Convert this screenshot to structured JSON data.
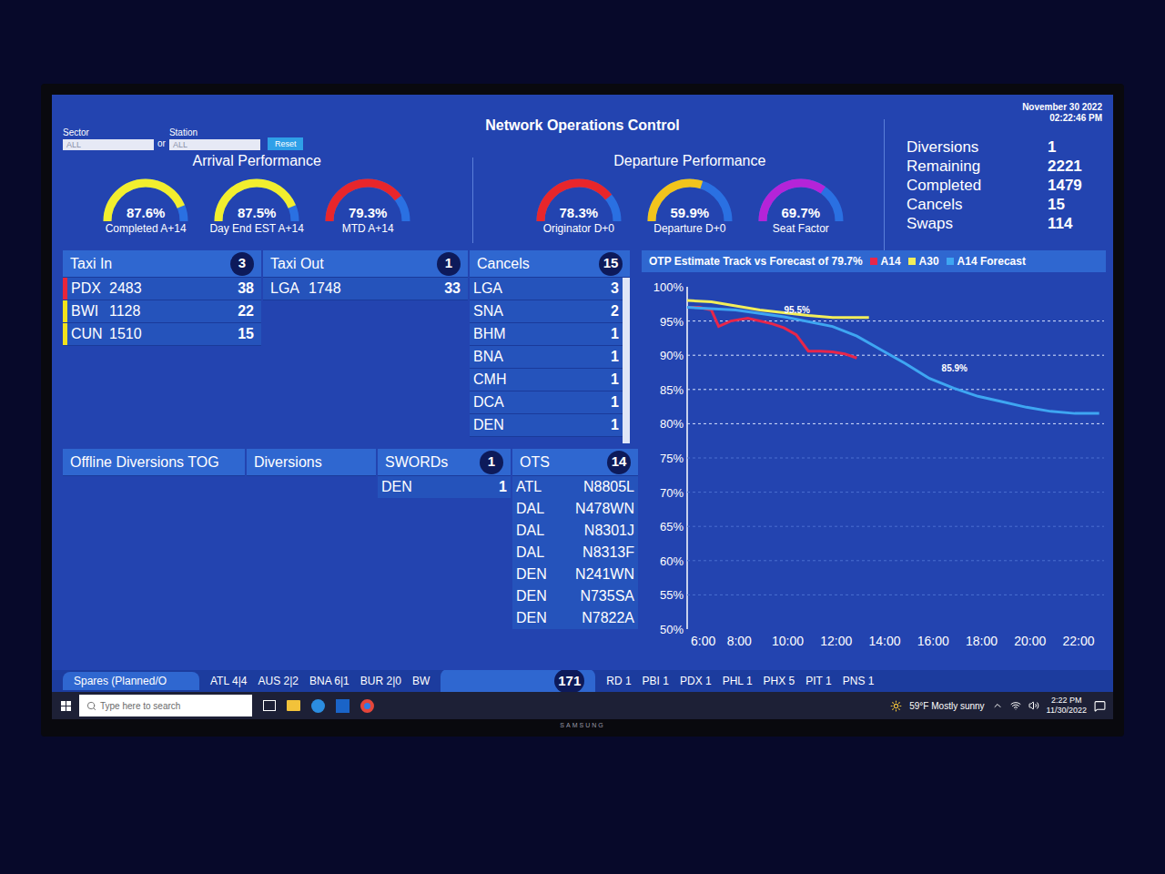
{
  "screen": {
    "title": "Network Operations Control",
    "date": "November 30 2022",
    "time": "02:22:46 PM"
  },
  "filters": {
    "sector_label": "Sector",
    "sector_value": "ALL",
    "or": "or",
    "station_label": "Station",
    "station_value": "ALL",
    "reset": "Reset"
  },
  "arrival": {
    "title": "Arrival Performance",
    "gauges": [
      {
        "value": "87.6%",
        "label": "Completed A+14",
        "level": 0.876,
        "color": "#f2ee2e"
      },
      {
        "value": "87.5%",
        "label": "Day End EST A+14",
        "level": 0.875,
        "color": "#f2ee2e"
      },
      {
        "value": "79.3%",
        "label": "MTD A+14",
        "level": 0.793,
        "color": "#e8262b"
      }
    ]
  },
  "departure": {
    "title": "Departure Performance",
    "gauges": [
      {
        "value": "78.3%",
        "label": "Originator D+0",
        "level": 0.783,
        "color": "#e8262b"
      },
      {
        "value": "59.9%",
        "label": "Departure D+0",
        "level": 0.599,
        "color": "#f2c41c"
      },
      {
        "value": "69.7%",
        "label": "Seat Factor",
        "level": 0.697,
        "color": "#b424d8"
      }
    ]
  },
  "stats": [
    {
      "label": "Diversions",
      "value": "1"
    },
    {
      "label": "Remaining",
      "value": "2221"
    },
    {
      "label": "Completed",
      "value": "1479"
    },
    {
      "label": "Cancels",
      "value": "15"
    },
    {
      "label": "Swaps",
      "value": "114"
    }
  ],
  "taxi_in": {
    "title": "Taxi In",
    "count": "3",
    "rows": [
      {
        "station": "PDX",
        "flight": "2483",
        "minutes": "38",
        "color": "#e8263a"
      },
      {
        "station": "BWI",
        "flight": "1128",
        "minutes": "22",
        "color": "#f2e21c"
      },
      {
        "station": "CUN",
        "flight": "1510",
        "minutes": "15",
        "color": "#f2e21c"
      }
    ]
  },
  "taxi_out": {
    "title": "Taxi Out",
    "count": "1",
    "rows": [
      {
        "station": "LGA",
        "flight": "1748",
        "minutes": "33"
      }
    ]
  },
  "cancels": {
    "title": "Cancels",
    "count": "15",
    "rows": [
      {
        "station": "LGA",
        "count": "3"
      },
      {
        "station": "SNA",
        "count": "2"
      },
      {
        "station": "BHM",
        "count": "1"
      },
      {
        "station": "BNA",
        "count": "1"
      },
      {
        "station": "CMH",
        "count": "1"
      },
      {
        "station": "DCA",
        "count": "1"
      },
      {
        "station": "DEN",
        "count": "1"
      }
    ]
  },
  "offline_diversions": {
    "title": "Offline Diversions TOG"
  },
  "diversions": {
    "title": "Diversions"
  },
  "swords": {
    "title": "SWORDs",
    "count": "1",
    "rows": [
      {
        "station": "DEN",
        "count": "1"
      }
    ]
  },
  "ots": {
    "title": "OTS",
    "count": "14",
    "rows": [
      {
        "station": "ATL",
        "tail": "N8805L"
      },
      {
        "station": "DAL",
        "tail": "N478WN"
      },
      {
        "station": "DAL",
        "tail": "N8301J"
      },
      {
        "station": "DAL",
        "tail": "N8313F"
      },
      {
        "station": "DEN",
        "tail": "N241WN"
      },
      {
        "station": "DEN",
        "tail": "N735SA"
      },
      {
        "station": "DEN",
        "tail": "N7822A"
      }
    ]
  },
  "chart": {
    "title": "OTP Estimate Track vs Forecast of 79.7%",
    "y_ticks": [
      "100%",
      "95%",
      "90%",
      "85%",
      "80%",
      "75%",
      "70%",
      "65%",
      "60%",
      "55%",
      "50%"
    ],
    "x_ticks": [
      "6:00",
      "8:00",
      "10:00",
      "12:00",
      "14:00",
      "16:00",
      "18:00",
      "20:00",
      "22:00"
    ],
    "series": [
      {
        "name": "A14",
        "color": "#e8264a",
        "x": [
          6,
          6.5,
          7,
          7.3,
          7.8,
          8.5,
          9.5,
          10,
          10.5,
          11,
          11.5,
          12,
          12.5,
          13
        ],
        "values": [
          97,
          97,
          96.6,
          94.2,
          95,
          95.4,
          94.6,
          94,
          93,
          90.6,
          90.6,
          90.5,
          90.2,
          89.6
        ]
      },
      {
        "name": "A30",
        "color": "#f2ee5a",
        "x": [
          6,
          7,
          8,
          9,
          10,
          11,
          12,
          13,
          13.5
        ],
        "values": [
          98,
          97.8,
          97.2,
          96.6,
          96.2,
          95.8,
          95.5,
          95.5,
          95.5
        ]
      },
      {
        "name": "A14 Forecast",
        "color": "#3ea6f2",
        "x": [
          6,
          8,
          10,
          12,
          13,
          14,
          15,
          16,
          17,
          18,
          19,
          20,
          21,
          22,
          23
        ],
        "values": [
          97,
          96.6,
          95.6,
          94.2,
          92.8,
          90.8,
          88.8,
          86.6,
          85.2,
          84,
          83.2,
          82.4,
          81.8,
          81.5,
          81.5
        ]
      }
    ],
    "annotations": [
      {
        "text": "95.5%",
        "x": 10,
        "y": 96.2
      },
      {
        "text": "85.9%",
        "x": 16.5,
        "y": 87.6
      }
    ]
  },
  "ticker": {
    "tab": "Spares (Planned/O",
    "items": [
      "ATL 4|4",
      "AUS 2|2",
      "BNA 6|1",
      "BUR 2|0",
      "BW"
    ],
    "delays_count": "171",
    "right_items": [
      "RD 1",
      "PBI 1",
      "PDX 1",
      "PHL 1",
      "PHX 5",
      "PIT 1",
      "PNS 1"
    ]
  },
  "taskbar": {
    "search_placeholder": "Type here to search",
    "weather": "59°F Mostly sunny",
    "time": "2:22 PM",
    "date": "11/30/2022"
  },
  "monitor": {
    "brand": "SAMSUNG"
  }
}
